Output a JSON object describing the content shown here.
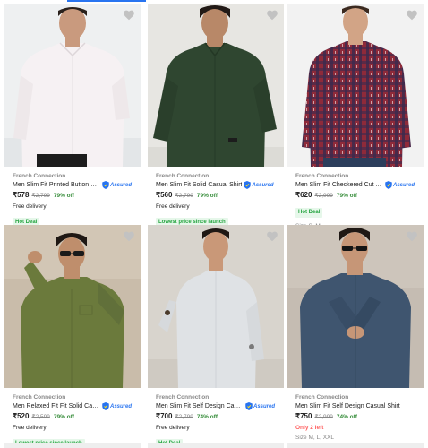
{
  "colors": {
    "discount": "#388e3c",
    "assured": "#2874f0",
    "deal_badge": "#26a541",
    "stock_warning": "#ff6161"
  },
  "icons": {
    "wishlist": "heart-icon",
    "assured": "assured-shield-icon"
  },
  "assured_label": "Assured",
  "products": [
    {
      "brand": "French Connection",
      "title": "Men Slim Fit Printed Button Dow...",
      "assured": true,
      "price": "₹578",
      "mrp": "₹2,799",
      "discount": "79% off",
      "delivery": "Free delivery",
      "badge": "Hot Deal",
      "shirt_color": "#f3eff1"
    },
    {
      "brand": "French Connection",
      "title": "Men Slim Fit Solid Casual Shirt",
      "assured": true,
      "price": "₹560",
      "mrp": "₹2,799",
      "discount": "79% off",
      "delivery": "Free delivery",
      "badge": "Lowest price since launch",
      "shirt_color": "#2f4630"
    },
    {
      "brand": "French Connection",
      "title": "Men Slim Fit Checkered Cut Awa...",
      "assured": true,
      "price": "₹620",
      "mrp": "₹2,999",
      "discount": "79% off",
      "badge": "Hot Deal",
      "size": "Size S, M",
      "shirt_color": "#8e2a3a"
    },
    {
      "brand": "French Connection",
      "title": "Men Relaxed Fit Fit Solid Casual ...",
      "assured": true,
      "price": "₹520",
      "mrp": "₹2,599",
      "discount": "79% off",
      "delivery": "Free delivery",
      "badge": "Lowest price since launch",
      "shirt_color": "#6b7a3c"
    },
    {
      "brand": "French Connection",
      "title": "Men Slim Fit Self Design Casual ...",
      "assured": true,
      "price": "₹700",
      "mrp": "₹2,799",
      "discount": "74% off",
      "delivery": "Free delivery",
      "badge": "Hot Deal",
      "shirt_color": "#dfe2e5"
    },
    {
      "brand": "French Connection",
      "title": "Men Slim Fit Self Design Casual Shirt",
      "assured": false,
      "price": "₹750",
      "mrp": "₹2,999",
      "discount": "74% off",
      "only_left": "Only 2 left",
      "size": "Size M, L, XXL",
      "shirt_color": "#3f556f"
    }
  ]
}
